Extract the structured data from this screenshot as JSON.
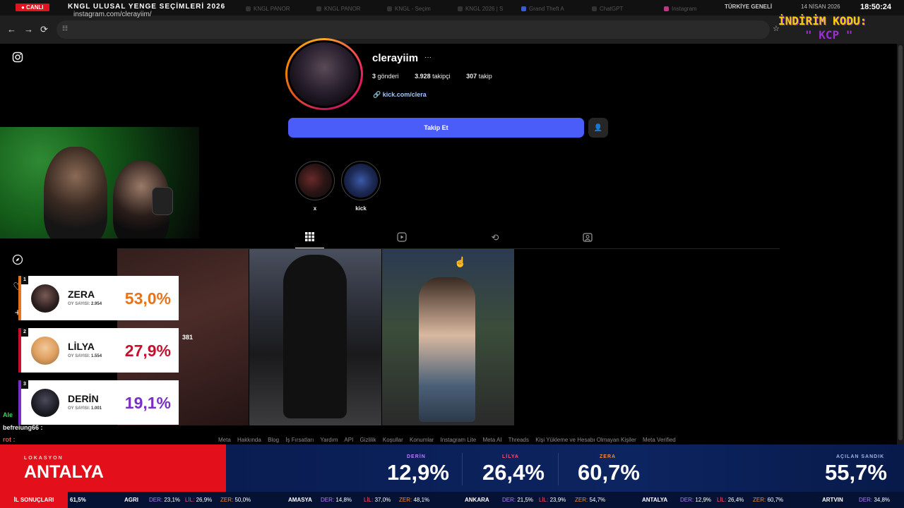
{
  "stream": {
    "live_label": "● CANLI",
    "title": "KNGL ULUSAL YENGE SEÇİMLERİ 2026",
    "region": "TÜRKİYE GENELİ",
    "date": "14 NİSAN 2026",
    "time": "18:50:24",
    "promo_line1": "İNDİRİM KODU:",
    "promo_line2": "\" KCP \""
  },
  "browser": {
    "tabs": [
      "KNGL PANOR",
      "KNGL PANOR",
      "KNGL - Seçim",
      "KNGL 2026 | S",
      "Grand Theft A",
      "ChatGPT",
      "Instagram"
    ],
    "url": "instagram.com/clerayiim/"
  },
  "profile": {
    "username": "clerayiim",
    "more": "···",
    "posts_count": "3",
    "posts_label": "gönderi",
    "followers_count": "3.928",
    "followers_label": "takipçi",
    "following_count": "307",
    "following_label": "takip",
    "link": "kick.com/clera",
    "follow_button": "Takip Et",
    "highlights": [
      {
        "label": "x"
      },
      {
        "label": "kick"
      }
    ]
  },
  "overlay_number": "381",
  "footer_links": [
    "Meta",
    "Hakkında",
    "Blog",
    "İş Fırsatları",
    "Yardım",
    "API",
    "Gizlilik",
    "Koşullar",
    "Konumlar",
    "Instagram Lite",
    "Meta AI",
    "Threads",
    "Kişi Yükleme ve Hesabı Olmayan Kişiler",
    "Meta Verified"
  ],
  "leaderboard": [
    {
      "rank": "1",
      "name": "ZERA",
      "votes_label": "OY SAYISI:",
      "votes": "2.954",
      "pct": "53,0%",
      "color": "#e8731a"
    },
    {
      "rank": "2",
      "name": "LİLYA",
      "votes_label": "OY SAYISI:",
      "votes": "1.554",
      "pct": "27,9%",
      "color": "#c8102e"
    },
    {
      "rank": "3",
      "name": "DERİN",
      "votes_label": "OY SAYISI:",
      "votes": "1.001",
      "pct": "19,1%",
      "color": "#7b2fc9"
    }
  ],
  "chat": [
    {
      "user": "Ale",
      "text": ""
    },
    {
      "user": "befreiung66",
      "text": ":"
    },
    {
      "user": "rot",
      "text": ":"
    }
  ],
  "bottom": {
    "location_label": "LOKASYON",
    "location": "ANTALYA",
    "candidates": [
      {
        "label": "DERİN",
        "pct": "12,9%",
        "color": "#b57cff"
      },
      {
        "label": "LİLYA",
        "pct": "26,4%",
        "color": "#ff4d6d"
      },
      {
        "label": "ZERA",
        "pct": "60,7%",
        "color": "#ff8a2a"
      }
    ],
    "opened_label": "AÇILAN SANDIK",
    "opened_pct": "55,7%"
  },
  "ticker": {
    "head": "İL SONUÇLARI",
    "lead": "61,5%",
    "items": [
      {
        "city": "AGRI",
        "der": "23,1%",
        "lil": "26,9%",
        "zer": "50,0%"
      },
      {
        "city": "AMASYA",
        "der": "14,8%",
        "lil": "37,0%",
        "zer": "48,1%"
      },
      {
        "city": "ANKARA",
        "der": "21,5%",
        "lil": "23,9%",
        "zer": "54,7%"
      },
      {
        "city": "ANTALYA",
        "der": "12,9%",
        "lil": "26,4%",
        "zer": "60,7%"
      },
      {
        "city": "ARTVIN",
        "der": "34,8%",
        "lil": "",
        "zer": ""
      }
    ]
  }
}
